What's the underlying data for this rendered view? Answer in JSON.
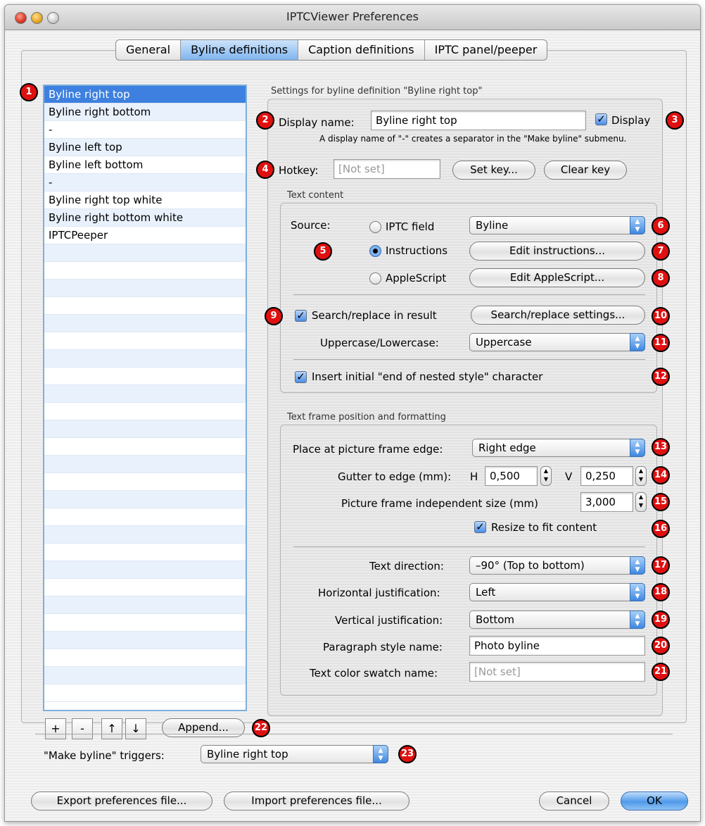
{
  "window": {
    "title": "IPTCViewer Preferences"
  },
  "tabs": [
    "General",
    "Byline definitions",
    "Caption definitions",
    "IPTC panel/peeper"
  ],
  "list": {
    "items": [
      "Byline right top",
      "Byline right bottom",
      "-",
      "Byline left top",
      "Byline left bottom",
      "-",
      "Byline right top white",
      "Byline right bottom white",
      "IPTCPeeper"
    ],
    "selected": "Byline right top"
  },
  "list_buttons": {
    "add": "+",
    "remove": "-",
    "up": "↑",
    "down": "↓",
    "append": "Append..."
  },
  "settings": {
    "title": "Settings for byline definition \"Byline right top\"",
    "display_name_label": "Display name:",
    "display_name_value": "Byline right top",
    "display_label": "Display",
    "display_hint": "A display name of \"-\" creates a separator in the \"Make byline\" submenu.",
    "hotkey_label": "Hotkey:",
    "hotkey_value": "[Not set]",
    "set_key": "Set key...",
    "clear_key": "Clear key"
  },
  "text_content": {
    "title": "Text content",
    "source_label": "Source:",
    "iptc_field_label": "IPTC field",
    "iptc_field_value": "Byline",
    "instructions_label": "Instructions",
    "edit_instructions": "Edit instructions...",
    "applescript_label": "AppleScript",
    "edit_applescript": "Edit AppleScript...",
    "selected_source": "Instructions",
    "search_replace_label": "Search/replace in result",
    "search_replace_settings": "Search/replace settings...",
    "case_label": "Uppercase/Lowercase:",
    "case_value": "Uppercase",
    "insert_label": "Insert initial \"end of nested style\" character"
  },
  "frame": {
    "title": "Text frame position and formatting",
    "edge_label": "Place at picture frame edge:",
    "edge_value": "Right edge",
    "gutter_label": "Gutter to edge (mm):",
    "h_label": "H",
    "h_value": "0,500",
    "v_label": "V",
    "v_value": "0,250",
    "size_label": "Picture frame independent size (mm)",
    "size_value": "3,000",
    "resize_label": "Resize to fit content",
    "direction_label": "Text direction:",
    "direction_value": "–90° (Top to bottom)",
    "hjust_label": "Horizontal justification:",
    "hjust_value": "Left",
    "vjust_label": "Vertical justification:",
    "vjust_value": "Bottom",
    "pstyle_label": "Paragraph style name:",
    "pstyle_value": "Photo byline",
    "swatch_label": "Text color swatch name:",
    "swatch_value": "[Not set]"
  },
  "triggers": {
    "label": "\"Make byline\" triggers:",
    "value": "Byline right top"
  },
  "footer": {
    "export": "Export preferences file...",
    "import": "Import preferences file...",
    "cancel": "Cancel",
    "ok": "OK"
  },
  "badges": [
    "1",
    "2",
    "3",
    "4",
    "5",
    "6",
    "7",
    "8",
    "9",
    "10",
    "11",
    "12",
    "13",
    "14",
    "15",
    "16",
    "17",
    "18",
    "19",
    "20",
    "21",
    "22",
    "23"
  ],
  "colors": {
    "accent": "#3d80df",
    "badge": "#e01010"
  }
}
